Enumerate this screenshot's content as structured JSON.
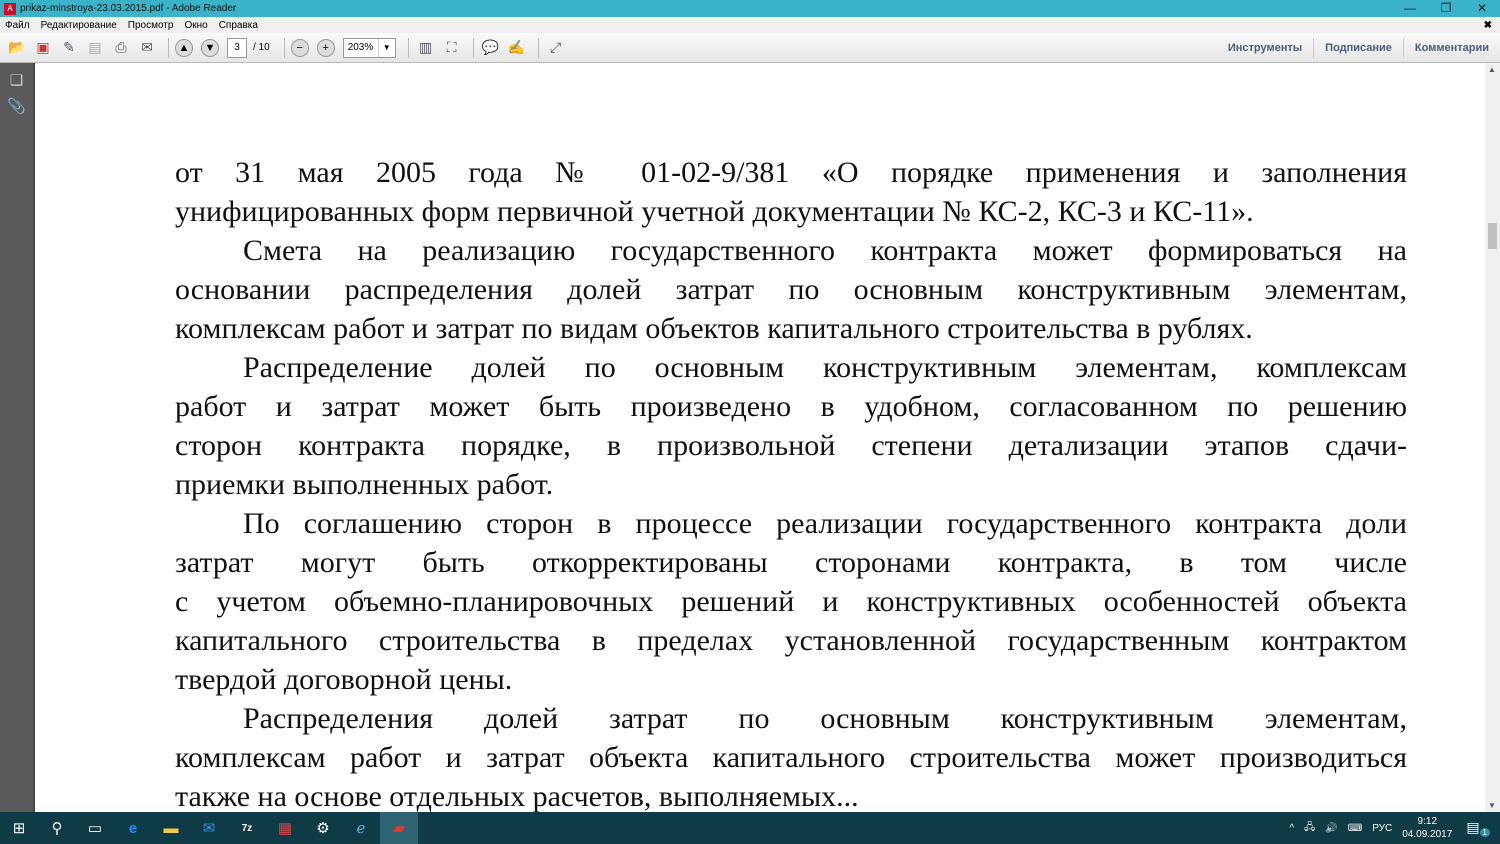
{
  "window": {
    "title": "prikaz-minstroya-23.03.2015.pdf - Adobe Reader",
    "minimize": "—",
    "restore": "❐",
    "close": "✕"
  },
  "menu": [
    "Файл",
    "Редактирование",
    "Просмотр",
    "Окно",
    "Справка"
  ],
  "menu_close": "✖",
  "toolbar": {
    "page_current": "3",
    "page_total": "/ 10",
    "zoom": "203%",
    "tabs": [
      "Инструменты",
      "Подписание",
      "Комментарии"
    ]
  },
  "document": {
    "paragraphs": [
      {
        "lines": [
          "от 31 мая 2005 года № 01-02-9/381 «О порядке применения и заполнения",
          "унифицированных форм первичной учетной документации № КС-2, КС-3 и КС-11»."
        ]
      },
      {
        "lines": [
          "Смета на реализацию государственного контракта может формироваться на",
          "основании распределения долей затрат по основным конструктивным элементам,",
          "комплексам работ и затрат по видам объектов капитального строительства в рублях."
        ]
      },
      {
        "lines": [
          "Распределение долей по основным конструктивным элементам, комплексам",
          "работ и затрат может быть произведено в удобном, согласованном по решению",
          "сторон контракта порядке, в произвольной степени детализации этапов сдачи-",
          "приемки выполненных работ."
        ]
      },
      {
        "lines": [
          "По соглашению сторон в процессе реализации государственного контракта доли",
          "затрат могут быть откорректированы сторонами контракта, в том числе",
          "с учетом объемно-планировочных решений и конструктивных особенностей объекта",
          "капитального строительства в пределах установленной государственным контрактом",
          "твердой договорной цены."
        ]
      },
      {
        "lines": [
          "Распределения долей затрат по основным конструктивным элементам,",
          "комплексам работ и затрат объекта капитального строительства может производиться",
          "также на основе отдельных расчетов, выполняемых..."
        ]
      }
    ]
  },
  "taskbar": {
    "keyboard_lang": "РУС",
    "time": "9:12",
    "date": "04.09.2017",
    "notifications": "1"
  }
}
